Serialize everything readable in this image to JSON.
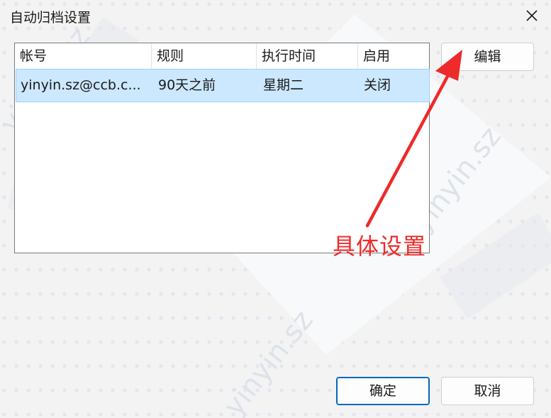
{
  "window": {
    "title": "自动归档设置"
  },
  "list": {
    "columns": [
      "帐号",
      "规则",
      "执行时间",
      "启用"
    ],
    "rows": [
      {
        "account": "yinyin.sz@ccb.c...",
        "rule": "90天之前",
        "time": "星期二",
        "enabled": "关闭",
        "selected": true
      }
    ]
  },
  "buttons": {
    "edit": "编辑",
    "ok": "确定",
    "cancel": "取消"
  },
  "annotation": {
    "text": "具体设置",
    "color": "#ee2a2a"
  },
  "watermark": {
    "text": "yinyin.sz"
  }
}
